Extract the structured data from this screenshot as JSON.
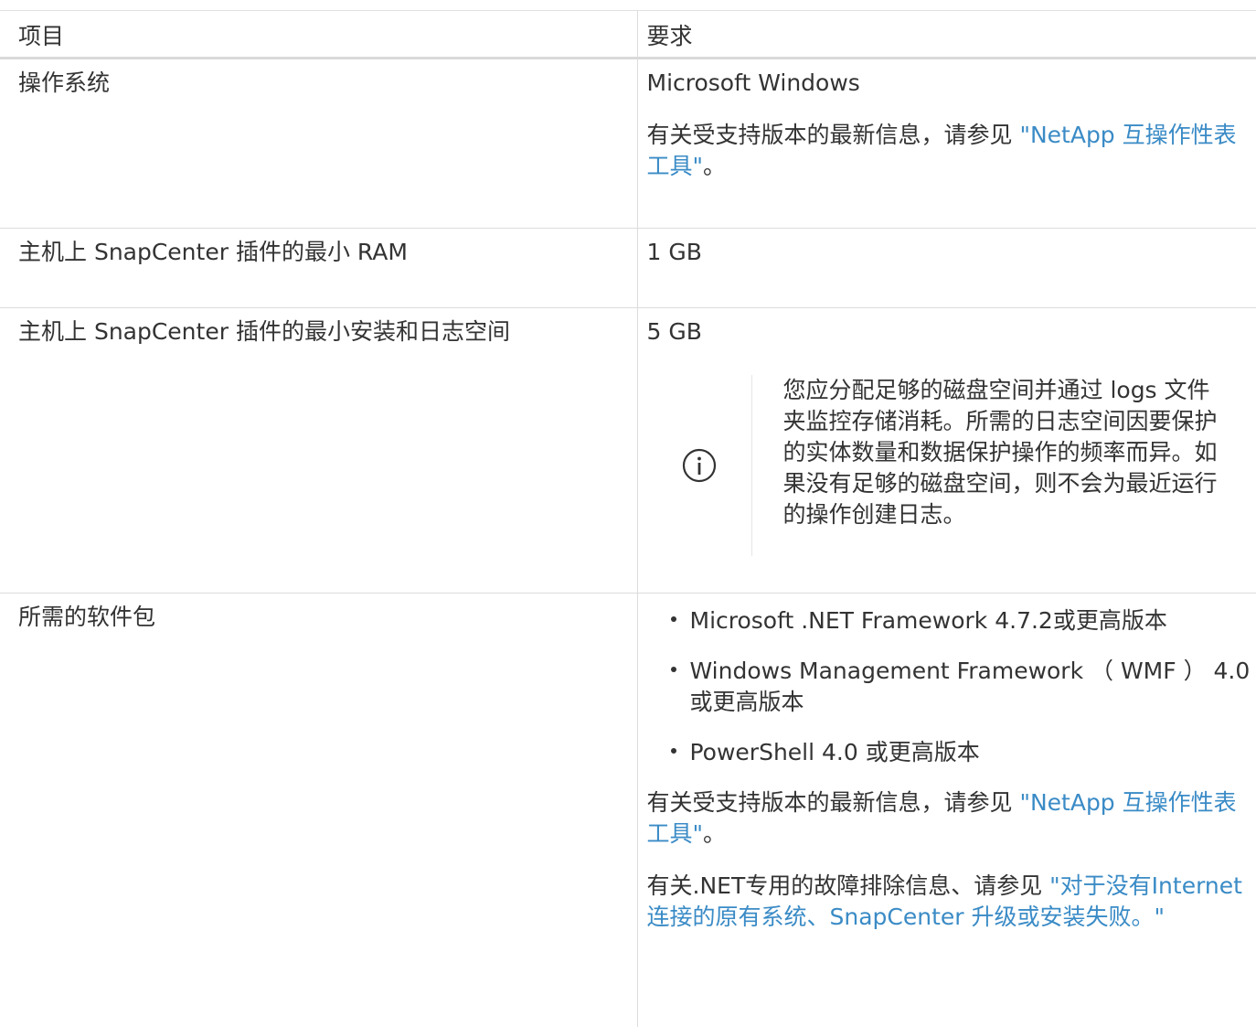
{
  "table": {
    "headers": [
      "项目",
      "要求"
    ],
    "rows": [
      {
        "item": "操作系统",
        "req_line1": "Microsoft Windows",
        "req_text": "有关受支持版本的最新信息，请参见 ",
        "req_link": "\"NetApp 互操作性表工具\"",
        "req_end": "。"
      },
      {
        "item": "主机上 SnapCenter 插件的最小 RAM",
        "req_line1": "1 GB"
      },
      {
        "item": "主机上 SnapCenter 插件的最小安装和日志空间",
        "req_line1": "5 GB",
        "note_icon": "info-icon",
        "note": "您应分配足够的磁盘空间并通过 logs 文件夹监控存储消耗。所需的日志空间因要保护的实体数量和数据保护操作的频率而异。如果没有足够的磁盘空间，则不会为最近运行的操作创建日志。"
      },
      {
        "item": "所需的软件包",
        "packages": [
          "Microsoft .NET Framework 4.7.2或更高版本",
          "Windows Management Framework （ WMF ） 4.0 或更高版本",
          "PowerShell 4.0 或更高版本"
        ],
        "req_text": "有关受支持版本的最新信息，请参见 ",
        "req_link": "\"NetApp 互操作性表工具\"",
        "req_end": "。",
        "net_text": "有关.NET专用的故障排除信息、请参见 ",
        "net_link": "\"对于没有Internet连接的原有系统、SnapCenter 升级或安装失败。\""
      }
    ]
  },
  "colors": {
    "text": "#333333",
    "link": "#3a8bc6",
    "border": "#dcdcdc"
  }
}
